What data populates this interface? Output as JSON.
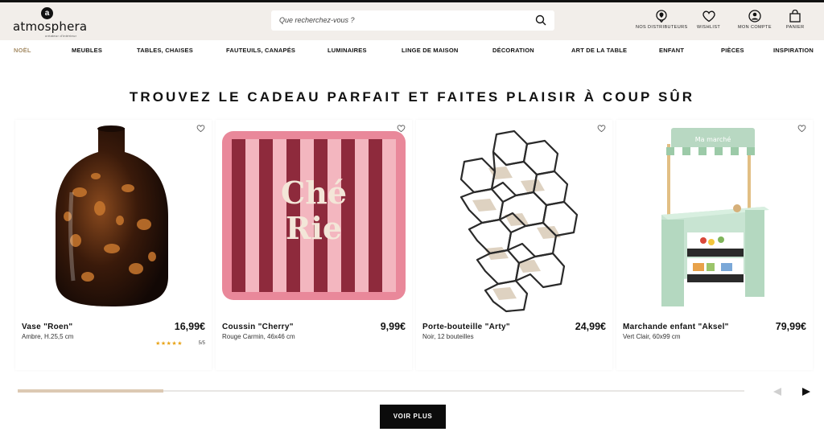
{
  "brand": {
    "name": "atmosphera",
    "mark": "a",
    "tagline": "créateur d'intérieur"
  },
  "search": {
    "placeholder": "Que recherchez-vous ?"
  },
  "header_links": [
    {
      "label": "NOS DISTRIBUTEURS",
      "icon": "location-pin-icon"
    },
    {
      "label": "WISHLIST",
      "icon": "heart-icon"
    },
    {
      "label": "MON COMPTE",
      "icon": "user-icon"
    },
    {
      "label": "PANIER",
      "icon": "bag-icon"
    }
  ],
  "nav": [
    "NOËL",
    "MEUBLES",
    "TABLES, CHAISES",
    "FAUTEUILS, CANAPÉS",
    "LUMINAIRES",
    "LINGE DE MAISON",
    "DÉCORATION",
    "ART DE LA TABLE",
    "ENFANT",
    "PIÈCES",
    "INSPIRATION"
  ],
  "nav_active": "NOËL",
  "section": {
    "title": "TROUVEZ LE CADEAU PARFAIT ET FAITES PLAISIR À COUP SÛR"
  },
  "products": [
    {
      "name": "Vase \"Roen\"",
      "desc": "Ambre, H.25,5 cm",
      "price": "16,99€",
      "stars": "★★★★★",
      "rating": "5/5"
    },
    {
      "name": "Coussin \"Cherry\"",
      "desc": "Rouge Carmin, 46x46 cm",
      "price": "9,99€"
    },
    {
      "name": "Porte-bouteille \"Arty\"",
      "desc": "Noir, 12 bouteilles",
      "price": "24,99€"
    },
    {
      "name": "Marchande enfant \"Aksel\"",
      "desc": "Vert Clair, 60x99 cm",
      "price": "79,99€"
    }
  ],
  "cushion_text": {
    "line1": "Ché",
    "line2": "Rie"
  },
  "stall_sign": "Ma marché",
  "carousel": {
    "progress": 0.2
  },
  "cta": {
    "label": "VOIR PLUS"
  },
  "colors": {
    "header_bg": "#f2eeea",
    "accent": "#a58c66",
    "progress": "#dcc9b3",
    "button": "#0b0b0b"
  }
}
